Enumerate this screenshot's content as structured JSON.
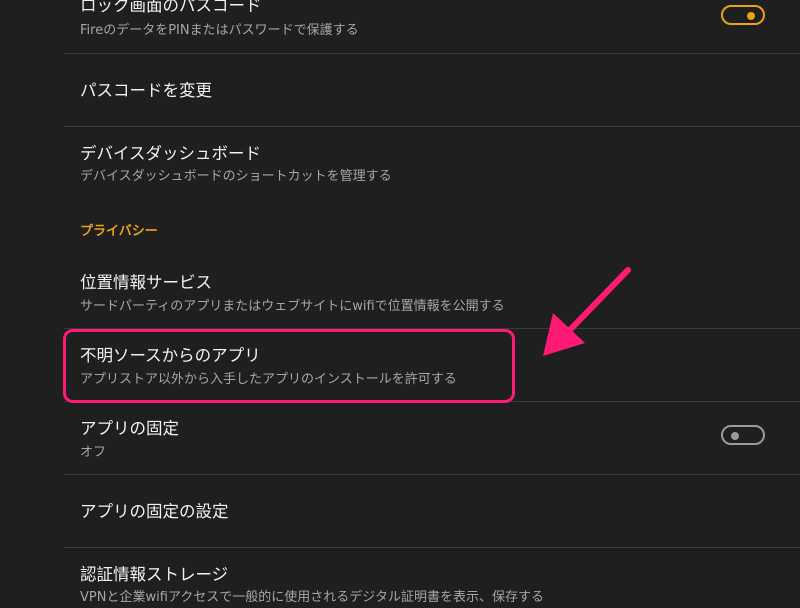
{
  "colors": {
    "background": "#1f1f1f",
    "accent": "#e8a317",
    "annotation": "#ff1a75",
    "divider": "#3a3a3a"
  },
  "settings": {
    "lock_screen": {
      "title": "ロック画面のパスコード",
      "subtitle": "FireのデータをPINまたはパスワードで保護する",
      "toggle": "on"
    },
    "change_passcode": {
      "title": "パスコードを変更"
    },
    "device_dashboard": {
      "title": "デバイスダッシュボード",
      "subtitle": "デバイスダッシュボードのショートカットを管理する"
    },
    "privacy_header": "プライバシー",
    "location": {
      "title": "位置情報サービス",
      "subtitle": "サードパーティのアプリまたはウェブサイトにwifiで位置情報を公開する"
    },
    "unknown_sources": {
      "title": "不明ソースからのアプリ",
      "subtitle": "アプリストア以外から入手したアプリのインストールを許可する"
    },
    "app_pinning": {
      "title": "アプリの固定",
      "subtitle": "オフ",
      "toggle": "off"
    },
    "app_pinning_settings": {
      "title": "アプリの固定の設定"
    },
    "credential_storage": {
      "title": "認証情報ストレージ",
      "subtitle": "VPNと企業wifiアクセスで一般的に使用されるデジタル証明書を表示、保存する"
    }
  }
}
